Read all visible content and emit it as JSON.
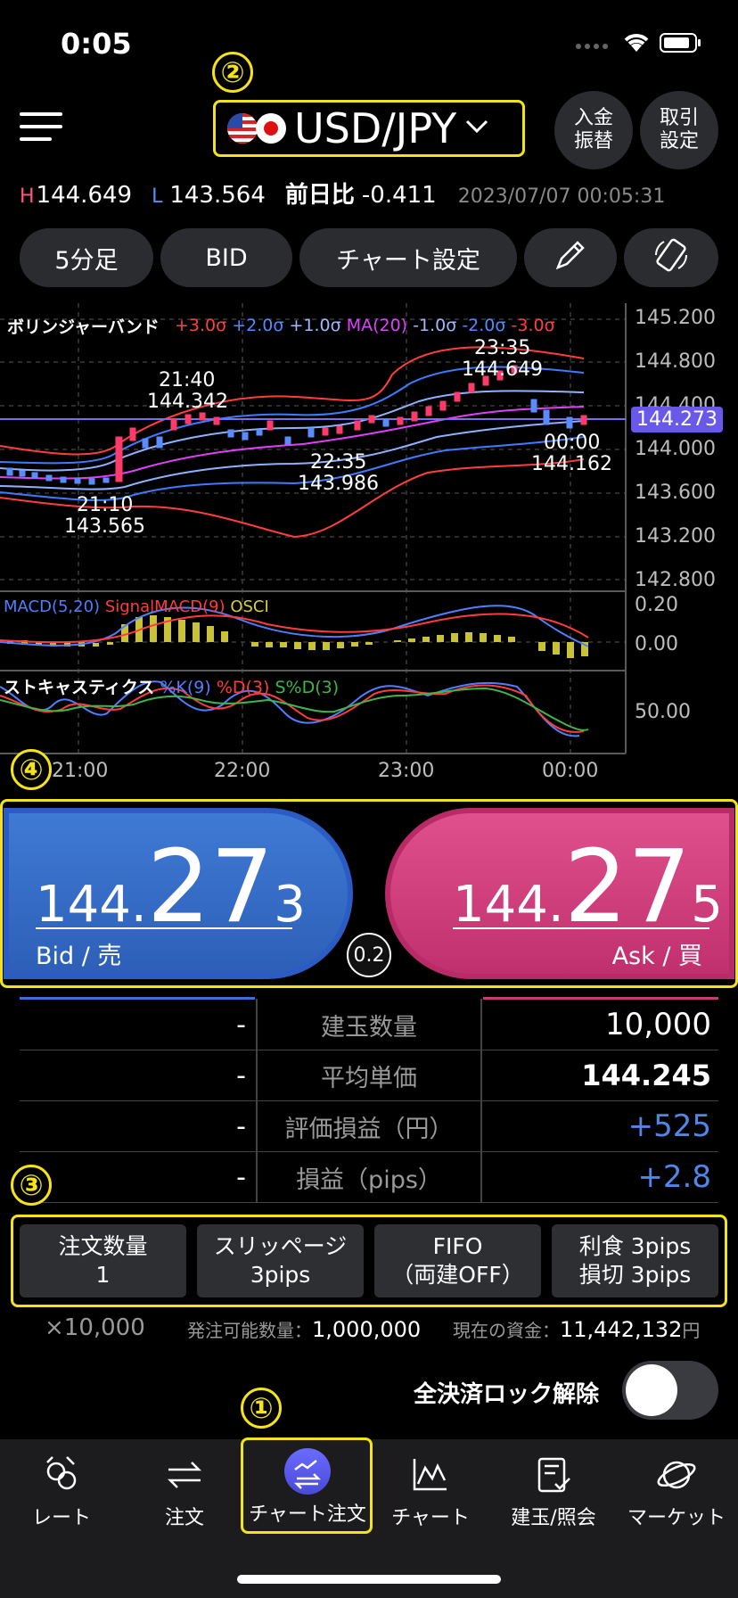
{
  "status_bar": {
    "time": "0:05"
  },
  "header": {
    "pair": "USD/JPY",
    "deposit_btn_line1": "入金",
    "deposit_btn_line2": "振替",
    "trade_btn_line1": "取引",
    "trade_btn_line2": "設定"
  },
  "quote_line": {
    "h_label": "H",
    "high": "144.649",
    "l_label": "L",
    "low": "143.564",
    "change_label": "前日比",
    "change": "-0.411",
    "datetime": "2023/07/07 00:05:31"
  },
  "toolbar": {
    "timeframe": "5分足",
    "side": "BID",
    "chart_settings": "チャート設定"
  },
  "chart": {
    "indicator_name": "ボリンジャーバンド",
    "legend": [
      "+3.0σ",
      "+2.0σ",
      "+1.0σ",
      "MA(20)",
      "-1.0σ",
      "-2.0σ",
      "-3.0σ"
    ],
    "legend_colors": [
      "#ff4040",
      "#4f8cff",
      "#9fb8ff",
      "#e040fb",
      "#9fb8ff",
      "#4f8cff",
      "#ff4040"
    ],
    "price_ticks": [
      "145.200",
      "144.800",
      "144.400",
      "144.000",
      "143.600",
      "143.200",
      "142.800"
    ],
    "current_price": "144.273",
    "annotations": [
      {
        "time": "21:40",
        "price": "144.342"
      },
      {
        "time": "23:35",
        "price": "144.649"
      },
      {
        "time": "22:35",
        "price": "143.986"
      },
      {
        "time": "00:00",
        "price": "144.162"
      },
      {
        "time": "21:10",
        "price": "143.565"
      }
    ],
    "macd_label": "MACD(5,20)",
    "signal_label": "SignalMACD(9)",
    "osci_label": "OSCI",
    "macd_ticks": [
      "0.20",
      "0.00"
    ],
    "stoch_label": "ストキャスティクス",
    "stoch_k": "%K(9)",
    "stoch_d": "%D(3)",
    "stoch_sd": "S%D(3)",
    "stoch_tick": "50.00",
    "time_ticks": [
      "21:00",
      "22:00",
      "23:00",
      "00:00"
    ]
  },
  "badges": {
    "one": "①",
    "two": "②",
    "three": "③",
    "four": "④"
  },
  "bid": {
    "prefix": "144.",
    "big": "27",
    "small": "3",
    "label": "Bid / 売"
  },
  "ask": {
    "prefix": "144.",
    "big": "27",
    "small": "5",
    "label": "Ask / 買"
  },
  "spread": "0.2",
  "position_table": [
    {
      "left": "-",
      "label": "建玉数量",
      "value": "10,000"
    },
    {
      "left": "-",
      "label": "平均単価",
      "value": "144.245"
    },
    {
      "left": "-",
      "label": "評価損益（円）",
      "value": "+525"
    },
    {
      "left": "-",
      "label": "損益（pips）",
      "value": "+2.8"
    }
  ],
  "options": {
    "qty_label": "注文数量",
    "qty_value": "1",
    "slip_label": "スリッページ",
    "slip_value": "3pips",
    "fifo_label": "FIFO",
    "fifo_value": "（両建OFF）",
    "tp_label": "利食 3pips",
    "sl_label": "損切 3pips"
  },
  "info": {
    "multiplier": "×10,000",
    "orderable_label": "発注可能数量：",
    "orderable_value": "1,000,000",
    "funds_label": "現在の資金：",
    "funds_value": "11,442,132",
    "funds_unit": "円"
  },
  "lock": {
    "label": "全決済ロック解除"
  },
  "nav": [
    {
      "label": "レート"
    },
    {
      "label": "注文"
    },
    {
      "label": "チャート注文"
    },
    {
      "label": "チャート"
    },
    {
      "label": "建玉/照会"
    },
    {
      "label": "マーケット"
    }
  ]
}
